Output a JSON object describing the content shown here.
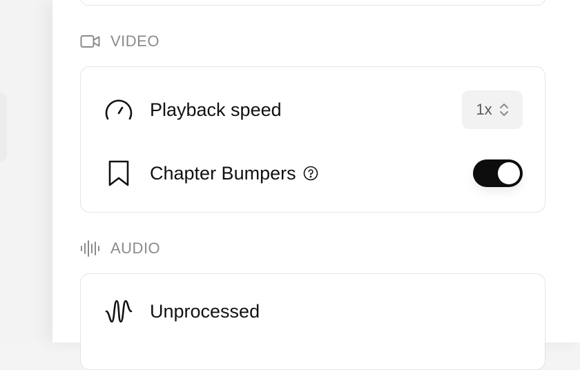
{
  "sections": {
    "video": {
      "title": "VIDEO",
      "icon": "video-camera-icon",
      "playback_speed": {
        "label": "Playback speed",
        "value": "1x",
        "icon": "speedometer-icon"
      },
      "chapter_bumpers": {
        "label": "Chapter Bumpers",
        "enabled": true,
        "icon": "bookmark-icon",
        "help_icon": "help-circle-icon"
      }
    },
    "audio": {
      "title": "AUDIO",
      "icon": "audio-waveform-icon",
      "unprocessed": {
        "label": "Unprocessed",
        "icon": "wave-icon"
      }
    }
  },
  "colors": {
    "toggle_on": "#0d0d0d",
    "section_label": "#8a8a8a",
    "card_border": "#e3e3e3"
  }
}
